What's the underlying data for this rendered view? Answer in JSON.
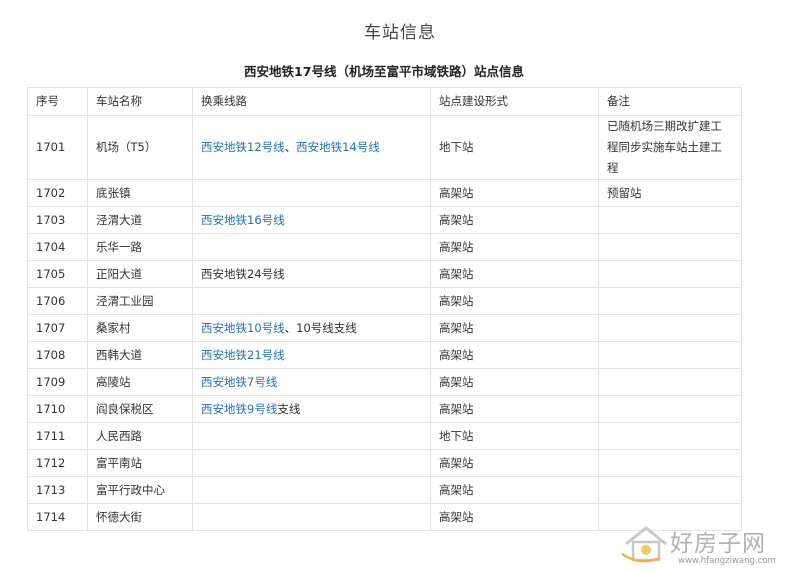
{
  "page_title": "车站信息",
  "table_caption": "西安地铁17号线（机场至富平市域铁路）站点信息",
  "columns": [
    "序号",
    "车站名称",
    "换乘线路",
    "站点建设形式",
    "备注"
  ],
  "rows": [
    {
      "id": "1701",
      "name": "机场（T5）",
      "transfer": [
        {
          "text": "西安地铁12号线",
          "link": true
        },
        {
          "text": "、",
          "link": false
        },
        {
          "text": "西安地铁14号线",
          "link": true
        }
      ],
      "type": "地下站",
      "note": "已随机场三期改扩建工程同步实施车站土建工程"
    },
    {
      "id": "1702",
      "name": "底张镇",
      "transfer": [],
      "type": "高架站",
      "note": "预留站"
    },
    {
      "id": "1703",
      "name": "泾渭大道",
      "transfer": [
        {
          "text": "西安地铁16号线",
          "link": true
        }
      ],
      "type": "高架站",
      "note": ""
    },
    {
      "id": "1704",
      "name": "乐华一路",
      "transfer": [],
      "type": "高架站",
      "note": ""
    },
    {
      "id": "1705",
      "name": "正阳大道",
      "transfer": [
        {
          "text": "西安地铁24号线",
          "link": false
        }
      ],
      "type": "高架站",
      "note": ""
    },
    {
      "id": "1706",
      "name": "泾渭工业园",
      "transfer": [],
      "type": "高架站",
      "note": ""
    },
    {
      "id": "1707",
      "name": "桑家村",
      "transfer": [
        {
          "text": "西安地铁10号线",
          "link": true
        },
        {
          "text": "、10号线支线",
          "link": false
        }
      ],
      "type": "高架站",
      "note": ""
    },
    {
      "id": "1708",
      "name": "西韩大道",
      "transfer": [
        {
          "text": "西安地铁21号线",
          "link": true
        }
      ],
      "type": "高架站",
      "note": ""
    },
    {
      "id": "1709",
      "name": "高陵站",
      "transfer": [
        {
          "text": "西安地铁7号线",
          "link": true
        }
      ],
      "type": "高架站",
      "note": ""
    },
    {
      "id": "1710",
      "name": "阎良保税区",
      "transfer": [
        {
          "text": "西安地铁9号线",
          "link": true
        },
        {
          "text": "支线",
          "link": false
        }
      ],
      "type": "高架站",
      "note": ""
    },
    {
      "id": "1711",
      "name": "人民西路",
      "transfer": [],
      "type": "地下站",
      "note": ""
    },
    {
      "id": "1712",
      "name": "富平南站",
      "transfer": [],
      "type": "高架站",
      "note": ""
    },
    {
      "id": "1713",
      "name": "富平行政中心",
      "transfer": [],
      "type": "高架站",
      "note": ""
    },
    {
      "id": "1714",
      "name": "怀德大街",
      "transfer": [],
      "type": "高架站",
      "note": ""
    }
  ],
  "watermark": {
    "text": "好房子网",
    "url": "www.hfangziwang.com"
  },
  "colors": {
    "link": "#2b6fb6",
    "border": "#e4e4e4",
    "text": "#333333"
  }
}
